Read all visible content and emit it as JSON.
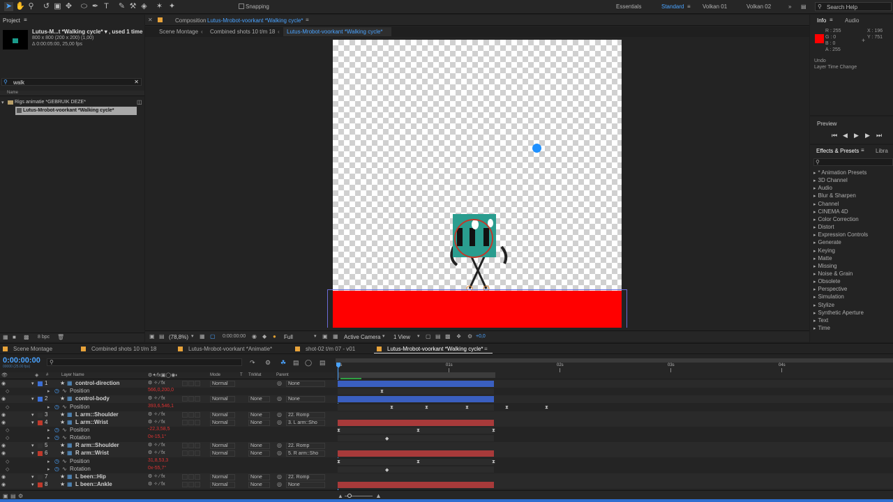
{
  "toolbar": {
    "snapping_label": "Snapping",
    "workspaces": [
      "Essentials",
      "Standard",
      "Volkan 01",
      "Volkan 02"
    ],
    "active_workspace": "Standard",
    "search_placeholder": "Search Help"
  },
  "project": {
    "title": "Project",
    "comp_name": "Lutus-M...t *Walking cycle* ▾ , used 1 time",
    "comp_dims": "800 x 800  (200 x 200) (1,00)",
    "comp_duration": "Δ 0:00:05:00, 25,00 fps",
    "search_value": "walk",
    "column_name": "Name",
    "folder": "Rigs animatie *GEBRUIK DEZE*",
    "item": "Lutus-Mrobot-voorkant *Walking cycle*",
    "bpc": "8 bpc"
  },
  "composition": {
    "panel_label": "Composition",
    "panel_comp": "Lutus-Mrobot-voorkant *Walking cycle*",
    "breadcrumbs": [
      "Scene Montage",
      "Combined shots 10 t/m 18",
      "Lutus-Mrobot-voorkant *Walking cycle*"
    ],
    "zoom": "(78,8%)",
    "timecode": "0:00:00:00",
    "resolution": "Full",
    "camera": "Active Camera",
    "views": "1 View",
    "exposure": "+0,0"
  },
  "info": {
    "tab_info": "Info",
    "tab_audio": "Audio",
    "r": "R : 255",
    "g": "G : 0",
    "b": "B : 0",
    "a": "A : 255",
    "x": "X : 196",
    "y": "Y : 751",
    "undo": "Undo",
    "undo_action": "Layer Time Change",
    "swatch_color": "#ff0000"
  },
  "preview": {
    "title": "Preview"
  },
  "effects": {
    "title": "Effects & Presets",
    "tab_libra": "Libra",
    "items": [
      "* Animation Presets",
      "3D Channel",
      "Audio",
      "Blur & Sharpen",
      "Channel",
      "CINEMA 4D",
      "Color Correction",
      "Distort",
      "Expression Controls",
      "Generate",
      "Keying",
      "Matte",
      "Missing",
      "Noise & Grain",
      "Obsolete",
      "Perspective",
      "Simulation",
      "Stylize",
      "Synthetic Aperture",
      "Text",
      "Time"
    ]
  },
  "timeline": {
    "tabs": [
      "Scene Montage",
      "Combined shots 10 t/m 18",
      "Lutus-Mrobot-voorkant *Animatie*",
      "shot-02 t/m 07 - v01",
      "Lutus-Mrobot-voorkant *Walking cycle*"
    ],
    "active_tab": 4,
    "timecode": "0:00:00:00",
    "timecode_sub": "00000 (25.00 fps)",
    "columns": {
      "num": "#",
      "layer_name": "Layer Name",
      "mode": "Mode",
      "t": "T",
      "trkmat": "TrkMat",
      "parent": "Parent"
    },
    "ruler": [
      "0s",
      "01s",
      "02s",
      "03s",
      "04s"
    ],
    "rows": [
      {
        "kind": "layer",
        "num": "1",
        "name": "control-direction",
        "label": "#3b6fd6",
        "mode": "Normal",
        "trk": "",
        "parent": "None",
        "bar": "#3a5fc0"
      },
      {
        "kind": "prop",
        "name": "Position",
        "value": "566,0,200,0",
        "kfs": [
          548
        ]
      },
      {
        "kind": "layer",
        "num": "2",
        "name": "control-body",
        "label": "#3b6fd6",
        "mode": "Normal",
        "trk": "None",
        "parent": "None",
        "bar": "#3a5fc0"
      },
      {
        "kind": "prop",
        "name": "Position",
        "value": "393,6,546,1",
        "kfs": [
          562,
          612,
          670,
          727,
          784
        ]
      },
      {
        "kind": "layer",
        "num": "3",
        "name": "L arm::Shoulder",
        "label": "",
        "mode": "Normal",
        "trk": "None",
        "parent": "22. Romp",
        "bar": ""
      },
      {
        "kind": "layer",
        "num": "4",
        "name": "L arm::Wrist",
        "label": "#c0392b",
        "mode": "Normal",
        "trk": "None",
        "parent": "3. L arm::Sho",
        "bar": "#a83a3a"
      },
      {
        "kind": "prop",
        "name": "Position",
        "value": "-22,3,58,5",
        "kfs": [
          486,
          600,
          708
        ]
      },
      {
        "kind": "prop",
        "name": "Rotation",
        "value": "0x-15,1°",
        "kfs": [
          555
        ]
      },
      {
        "kind": "layer",
        "num": "5",
        "name": "R arm::Shoulder",
        "label": "",
        "mode": "Normal",
        "trk": "None",
        "parent": "22. Romp",
        "bar": ""
      },
      {
        "kind": "layer",
        "num": "6",
        "name": "R arm::Wrist",
        "label": "#c0392b",
        "mode": "Normal",
        "trk": "None",
        "parent": "5. R arm::Sho",
        "bar": "#a83a3a"
      },
      {
        "kind": "prop",
        "name": "Position",
        "value": "31,8,53,3",
        "kfs": [
          486,
          600,
          708
        ]
      },
      {
        "kind": "prop",
        "name": "Rotation",
        "value": "0x-55,7°",
        "kfs": [
          555
        ]
      },
      {
        "kind": "layer",
        "num": "7",
        "name": "L been::Hip",
        "label": "",
        "mode": "Normal",
        "trk": "None",
        "parent": "22. Romp",
        "bar": ""
      },
      {
        "kind": "layer",
        "num": "8",
        "name": "L been::Ankle",
        "label": "#c0392b",
        "mode": "Normal",
        "trk": "None",
        "parent": "None",
        "bar": "#a83a3a"
      }
    ]
  }
}
